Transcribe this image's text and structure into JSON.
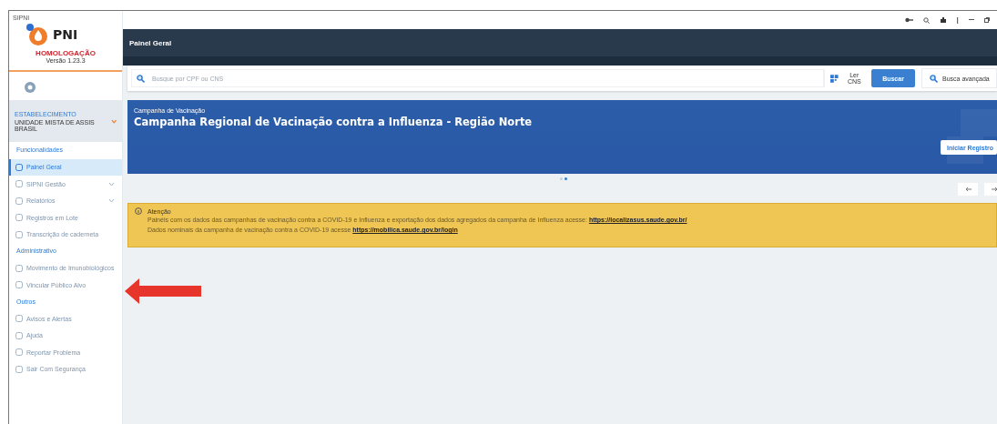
{
  "window": {
    "title": "SIPNI"
  },
  "brand": {
    "name": "PNI",
    "environment": "HOMOLOGAÇÃO",
    "version": "Versão 1.23.3"
  },
  "establishment": {
    "label": "ESTABELECIMENTO",
    "value": "UNIDADE MISTA DE ASSIS BRASIL"
  },
  "sidebar": {
    "items": [
      {
        "kind": "section",
        "label": "Funcionalidades"
      },
      {
        "kind": "item",
        "label": "Painel Geral",
        "selected": true,
        "expandable": false
      },
      {
        "kind": "item",
        "label": "SIPNI Gestão",
        "selected": false,
        "expandable": true
      },
      {
        "kind": "item",
        "label": "Relatórios",
        "selected": false,
        "expandable": true
      },
      {
        "kind": "item",
        "label": "Registros em Lote",
        "selected": false,
        "expandable": false
      },
      {
        "kind": "item",
        "label": "Transcrição de caderneta",
        "selected": false,
        "expandable": false
      },
      {
        "kind": "section",
        "label": "Administrativo"
      },
      {
        "kind": "item",
        "label": "Movimento de Imunobiológicos",
        "selected": false,
        "expandable": false
      },
      {
        "kind": "item",
        "label": "Vincular Público Alvo",
        "selected": false,
        "expandable": false
      },
      {
        "kind": "section",
        "label": "Outros"
      },
      {
        "kind": "item",
        "label": "Avisos e Alertas",
        "selected": false,
        "expandable": false
      },
      {
        "kind": "item",
        "label": "Ajuda",
        "selected": false,
        "expandable": false
      },
      {
        "kind": "item",
        "label": "Reportar Problema",
        "selected": false,
        "expandable": false
      },
      {
        "kind": "item",
        "label": "Sair Com Segurança",
        "selected": false,
        "expandable": false
      }
    ]
  },
  "header": {
    "title": "Painel Geral"
  },
  "search": {
    "placeholder": "Busque por CPF ou CNS",
    "read_button": "Ler CNS",
    "search_button": "Buscar",
    "advanced_button": "Busca avançada"
  },
  "banner": {
    "label": "Campanha de Vacinação",
    "title": "Campanha Regional de Vacinação contra a Influenza - Região Norte",
    "button": "Iniciar Registro"
  },
  "carousel": [
    {
      "selected": false
    },
    {
      "selected": true
    }
  ],
  "alert": {
    "title": "Atenção",
    "lines": [
      {
        "text": "Painéis com os dados das campanhas de vacinação contra a COVID-19 e Influenza e exportação dos dados agregados da campanha de Influenza acesse:",
        "link": "https://localizasus.saude.gov.br/"
      },
      {
        "text": "Dados nominais da campanha de vacinação contra a COVID-19 acesse",
        "link": "https://mobilica.saude.gov.br/login"
      }
    ]
  }
}
